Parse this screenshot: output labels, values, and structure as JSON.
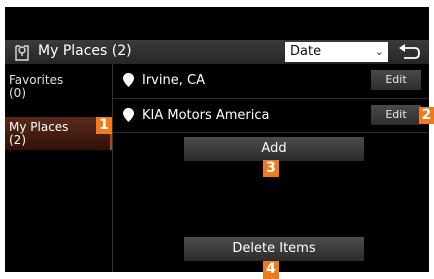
{
  "header": {
    "title": "My Places (2)",
    "sort": {
      "selected": "Date"
    }
  },
  "sidebar": {
    "items": [
      {
        "label": "Favorites\n(0)"
      },
      {
        "label": "My Places\n(2)"
      }
    ]
  },
  "places": [
    {
      "name": "Irvine, CA",
      "edit_label": "Edit"
    },
    {
      "name": "KIA Motors America",
      "edit_label": "Edit"
    }
  ],
  "actions": {
    "add_label": "Add",
    "delete_label": "Delete Items"
  },
  "markers": [
    "1",
    "2",
    "3",
    "4"
  ],
  "colors": {
    "marker": "#f07a1e",
    "selected_sidebar": "#5a2a1a",
    "background": "#000000"
  }
}
